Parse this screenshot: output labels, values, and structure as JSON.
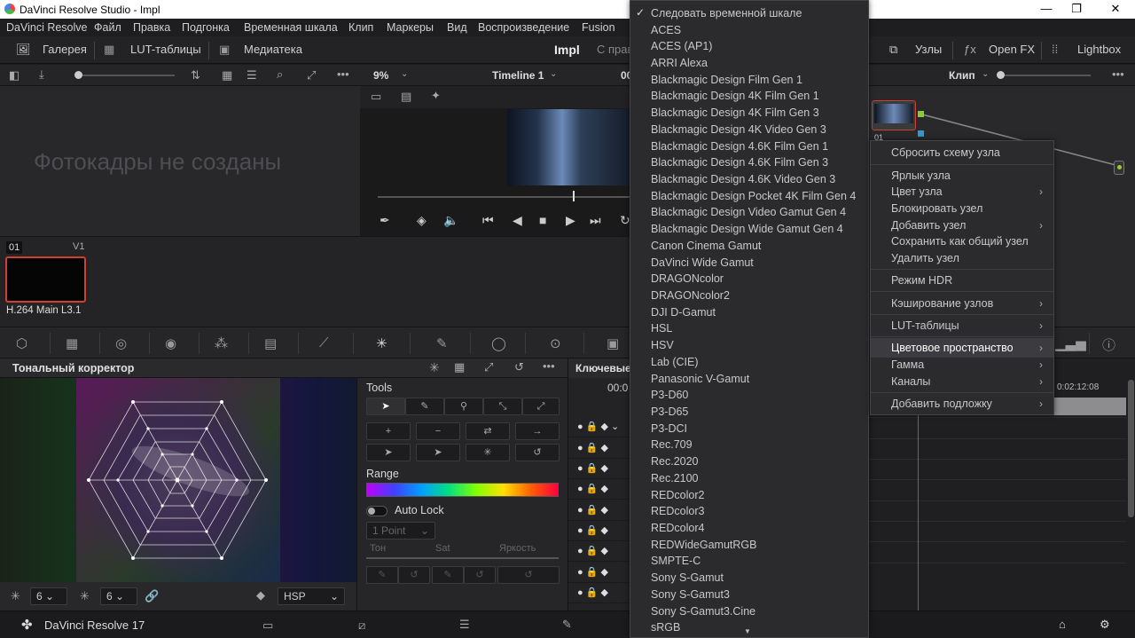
{
  "window": {
    "title": "DaVinci Resolve Studio - Impl",
    "minimize": "—",
    "maximize": "❐",
    "close": "✕"
  },
  "menubar": [
    "DaVinci Resolve",
    "Файл",
    "Правка",
    "Подгонка",
    "Временная шкала",
    "Клип",
    "Маркеры",
    "Вид",
    "Воспроизведение",
    "Fusion"
  ],
  "toolbar": {
    "gallery": "Галерея",
    "lut": "LUT-таблицы",
    "media": "Медиатека",
    "project": "Impl",
    "rights": "С прав",
    "nodes": "Узлы",
    "openfx": "Open FX",
    "lightbox": "Lightbox"
  },
  "viewer": {
    "zoom": "9%",
    "timeline": "Timeline 1",
    "timecode": "00",
    "clip_mode": "Клип"
  },
  "gallery": {
    "empty_text": "Фотокадры не созданы"
  },
  "clip": {
    "number": "01",
    "track": "V1",
    "codec": "H.264 Main L3.1"
  },
  "node": {
    "label": "01"
  },
  "colorpanel": {
    "title": "Тональный корректор",
    "footer_left_value": "6",
    "footer_mid_value": "6",
    "colorspace_select": "HSP"
  },
  "tools": {
    "title": "Tools",
    "range_label": "Range",
    "autolock_label": "Auto Lock",
    "point_select": "1 Point",
    "col_hue": "Тон",
    "col_sat": "Sat",
    "col_lum": "Яркость"
  },
  "keyframes": {
    "title": "Ключевые",
    "timecode": "00:0",
    "right_timecode": "0:02:12:08"
  },
  "bottombar": {
    "app_name": "DaVinci Resolve 17"
  },
  "dropdown": {
    "checked_item": "Следовать временной шкале",
    "items": [
      "Следовать временной шкале",
      "ACES",
      "ACES (AP1)",
      "ARRI Alexa",
      "Blackmagic Design Film Gen 1",
      "Blackmagic Design 4K Film Gen 1",
      "Blackmagic Design 4K Film Gen 3",
      "Blackmagic Design 4K Video Gen 3",
      "Blackmagic Design 4.6K Film Gen 1",
      "Blackmagic Design 4.6K Film Gen 3",
      "Blackmagic Design 4.6K Video Gen 3",
      "Blackmagic Design Pocket 4K Film Gen 4",
      "Blackmagic Design Video Gamut Gen 4",
      "Blackmagic Design Wide Gamut Gen 4",
      "Canon Cinema Gamut",
      "DaVinci Wide Gamut",
      "DRAGONcolor",
      "DRAGONcolor2",
      "DJI D-Gamut",
      "HSL",
      "HSV",
      "Lab (CIE)",
      "Panasonic V-Gamut",
      "P3-D60",
      "P3-D65",
      "P3-DCI",
      "Rec.709",
      "Rec.2020",
      "Rec.2100",
      "REDcolor2",
      "REDcolor3",
      "REDcolor4",
      "REDWideGamutRGB",
      "SMPTE-C",
      "Sony S-Gamut",
      "Sony S-Gamut3",
      "Sony S-Gamut3.Cine",
      "sRGB"
    ]
  },
  "context_menu": {
    "items": [
      {
        "label": "Сбросить схему узла",
        "sub": false
      },
      {
        "label": "Ярлык узла",
        "sub": false
      },
      {
        "label": "Цвет узла",
        "sub": true
      },
      {
        "label": "Блокировать узел",
        "sub": false
      },
      {
        "label": "Добавить узел",
        "sub": true
      },
      {
        "label": "Сохранить как общий узел",
        "sub": false
      },
      {
        "label": "Удалить узел",
        "sub": false
      },
      {
        "label": "Режим HDR",
        "sub": false
      },
      {
        "label": "Кэширование узлов",
        "sub": true
      },
      {
        "label": "LUT-таблицы",
        "sub": true
      },
      {
        "label": "Цветовое пространство",
        "sub": true
      },
      {
        "label": "Гамма",
        "sub": true
      },
      {
        "label": "Каналы",
        "sub": true
      },
      {
        "label": "Добавить подложку",
        "sub": true
      }
    ],
    "highlighted": "Цветовое пространство"
  },
  "colors": {
    "accent_red": "#d04030",
    "bg": "#1c1c1e",
    "playhead": "#d04030"
  }
}
